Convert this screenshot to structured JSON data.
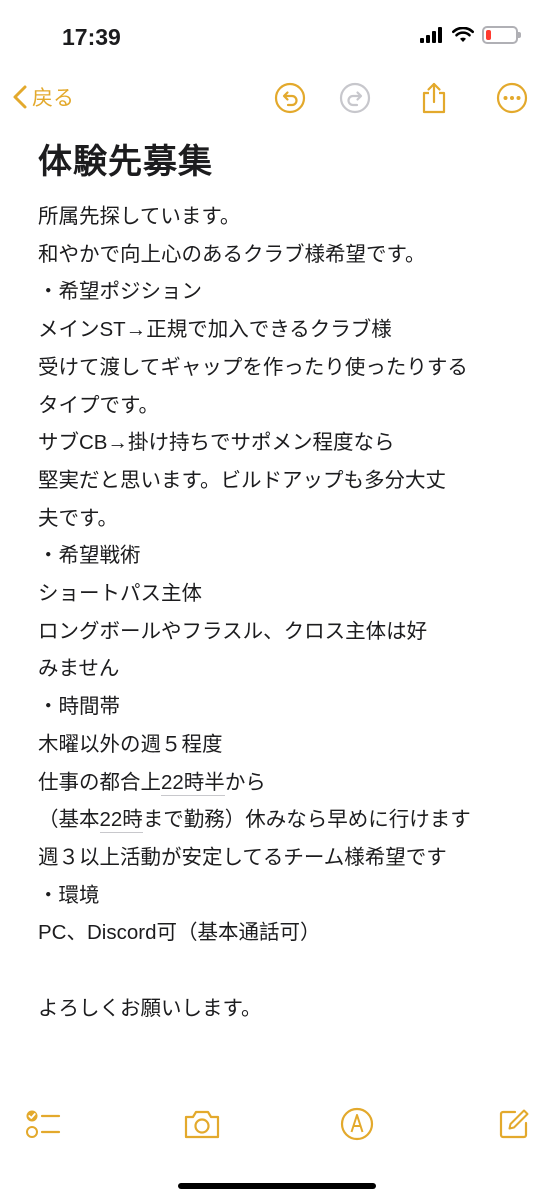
{
  "status_bar": {
    "time": "17:39",
    "battery_level": 0.18,
    "battery_color": "#ff3b30"
  },
  "nav": {
    "back_label": "戻る",
    "accent_color": "#e3a92c",
    "icons": [
      "chevron-left-icon",
      "undo-icon",
      "redo-icon",
      "share-icon",
      "more-icon"
    ]
  },
  "note": {
    "title": "体験先募集",
    "lines": [
      "所属先探しています。",
      "和やかで向上心のあるクラブ様希望です。",
      "・希望ポジション",
      "メインST→正規で加入できるクラブ様",
      "受けて渡してギャップを作ったり使ったりする",
      "タイプです。",
      "サブCB→掛け持ちでサポメン程度なら",
      "堅実だと思います。ビルドアップも多分大丈",
      "夫です。",
      "・希望戦術",
      "ショートパス主体",
      "ロングボールやフラスル、クロス主体は好",
      "みません",
      "・時間帯",
      "木曜以外の週５程度",
      "",
      "",
      "週３以上活動が安定してるチーム様希望です",
      "・環境",
      "PC、Discord可（基本通話可）",
      "",
      "よろしくお願いします。"
    ],
    "line16": {
      "before": "仕事の都合上",
      "link": "22時半",
      "after": "から"
    },
    "line17": {
      "before": "（基本",
      "link": "22時",
      "after": "まで勤務）休みなら早めに行けます"
    }
  },
  "toolbar": {
    "icons": [
      "checklist-icon",
      "camera-icon",
      "markup-pen-icon",
      "compose-icon"
    ]
  }
}
